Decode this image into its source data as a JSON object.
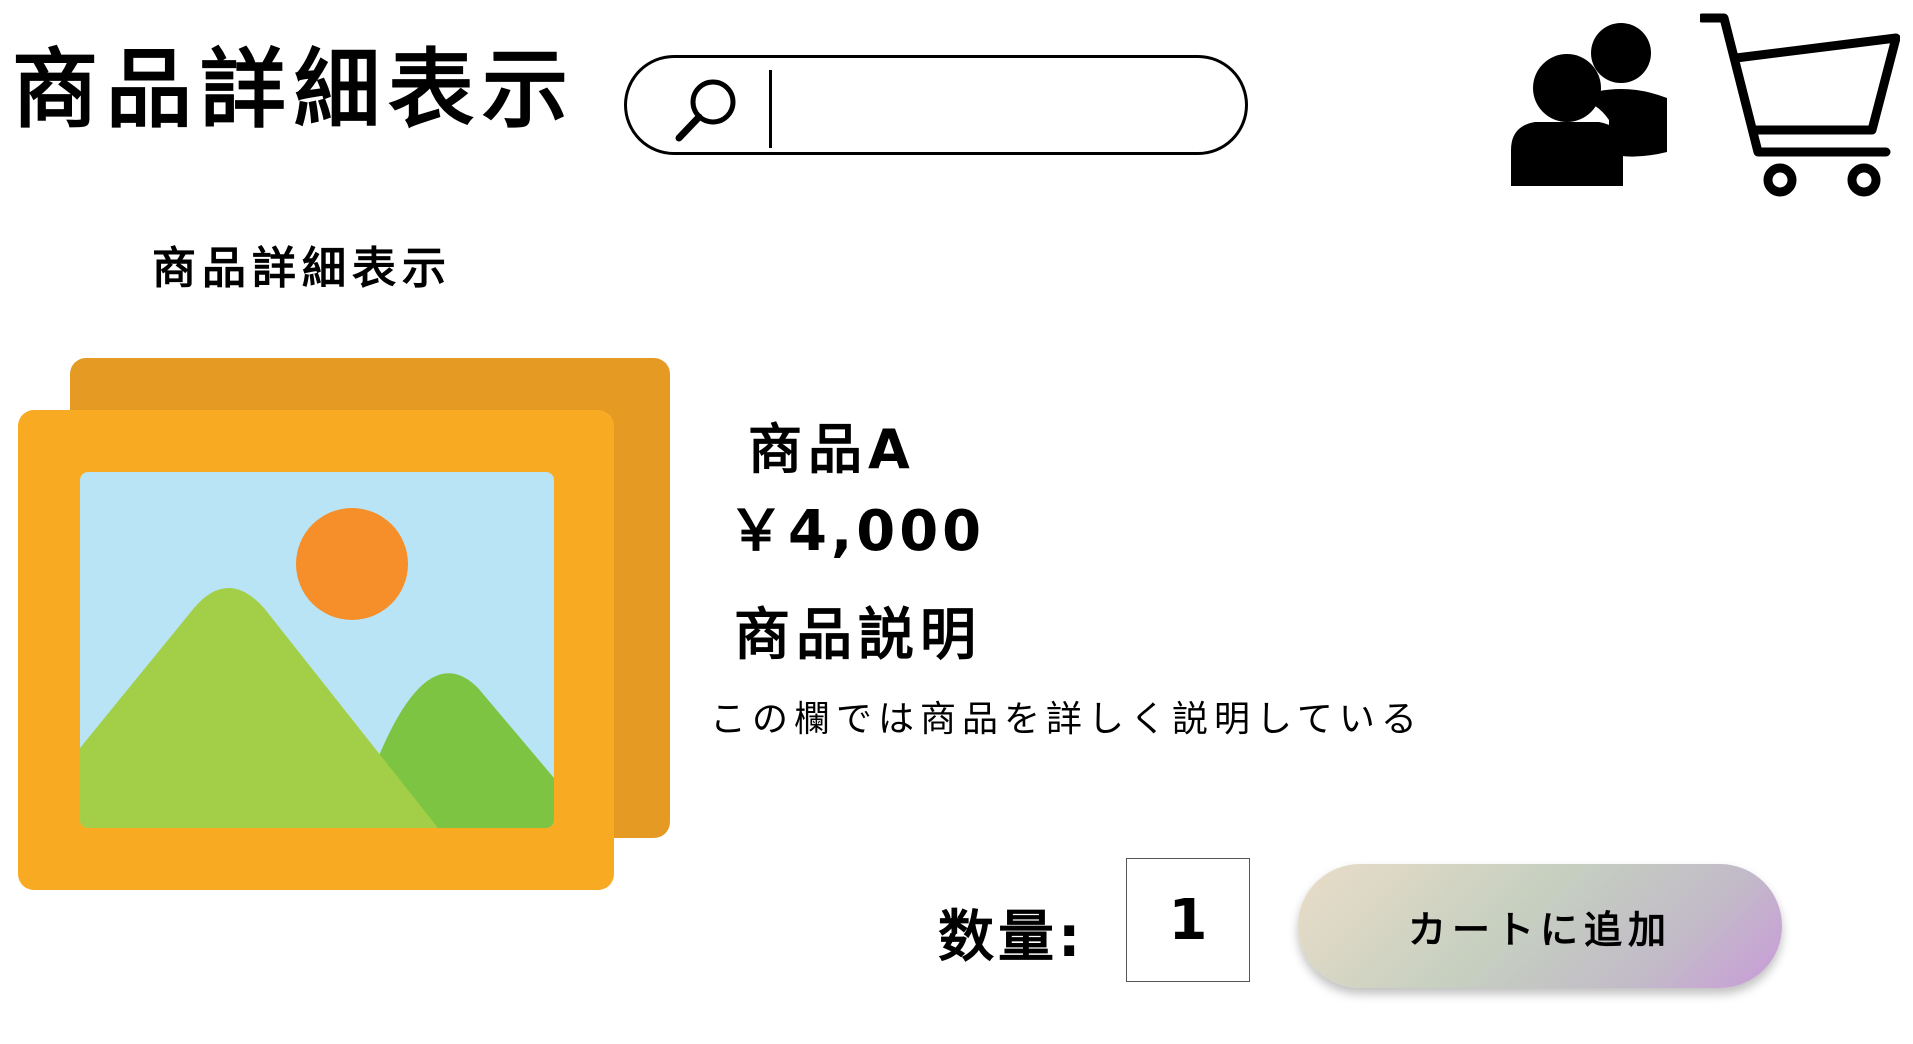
{
  "header": {
    "app_title": "商品詳細表示",
    "search": {
      "value": "",
      "placeholder": "",
      "icon": "search-icon"
    },
    "user_icon": "users-icon",
    "cart_icon": "shopping-cart-icon"
  },
  "page": {
    "subtitle": "商品詳細表示"
  },
  "product": {
    "image_icon": "image-placeholder-icon",
    "name": "商品A",
    "price": "￥4,000",
    "description_heading": "商品説明",
    "description": "この欄では商品を詳しく説明している"
  },
  "purchase": {
    "quantity_label": "数量:",
    "quantity_value": "1",
    "add_to_cart_label": "カートに追加"
  },
  "colors": {
    "image_frame_back": "#e59a24",
    "image_frame_front": "#f8aa22",
    "image_sky": "#b9e4f5",
    "image_sun": "#f68e29",
    "image_mountain_front": "#a3cf48",
    "image_mountain_back": "#7cc442",
    "button_gradient_start": "#e9ddc8",
    "button_gradient_end": "#c99ad9"
  }
}
